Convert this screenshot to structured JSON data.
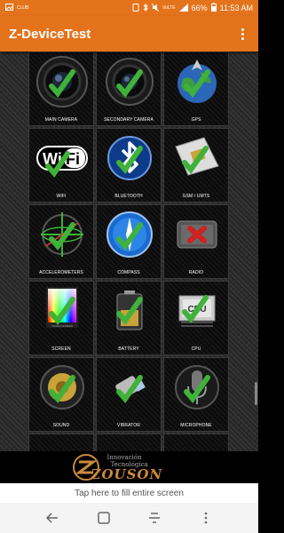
{
  "status_bar": {
    "carrier": "CLUB",
    "battery": "66%",
    "time": "11:53 AM",
    "volte": "VoLTE"
  },
  "app_bar": {
    "title": "Z-DeviceTest"
  },
  "tiles": [
    {
      "label": "MAIN CAMERA",
      "icon": "camera-icon"
    },
    {
      "label": "SECONDARY CAMERA",
      "icon": "camera-icon"
    },
    {
      "label": "GPS",
      "icon": "gps-icon"
    },
    {
      "label": "WIFI",
      "icon": "wifi-icon"
    },
    {
      "label": "BLUETOOTH",
      "icon": "bluetooth-icon"
    },
    {
      "label": "GSM / UMTS",
      "icon": "sim-card-icon"
    },
    {
      "label": "ACCELEROMETERS",
      "icon": "accelerometer-icon"
    },
    {
      "label": "COMPASS",
      "icon": "compass-icon"
    },
    {
      "label": "RADIO",
      "icon": "radio-icon"
    },
    {
      "label": "SCREEN",
      "icon": "screen-icon"
    },
    {
      "label": "BATTERY",
      "icon": "battery-icon"
    },
    {
      "label": "CPU",
      "icon": "cpu-icon"
    },
    {
      "label": "SOUND",
      "icon": "speaker-icon"
    },
    {
      "label": "VIBRATOR",
      "icon": "vibrator-icon"
    },
    {
      "label": "MICROPHONE",
      "icon": "microphone-icon"
    }
  ],
  "tile_extras": {
    "cpu_caption": "CPU",
    "wifi_text": "WiFi",
    "screen_caption": "TOUCH SCREEN"
  },
  "ad": {
    "tagline_1": "Innovación",
    "tagline_2": "Tecnológica",
    "brand": "ZOUSON"
  },
  "fill_bar": {
    "text": "Tap here to fill entire screen"
  },
  "nav": {
    "back": "back-icon",
    "home": "home-icon",
    "recents": "recents-icon"
  },
  "colors": {
    "accent": "#e4731c",
    "check": "#3fb23a"
  }
}
